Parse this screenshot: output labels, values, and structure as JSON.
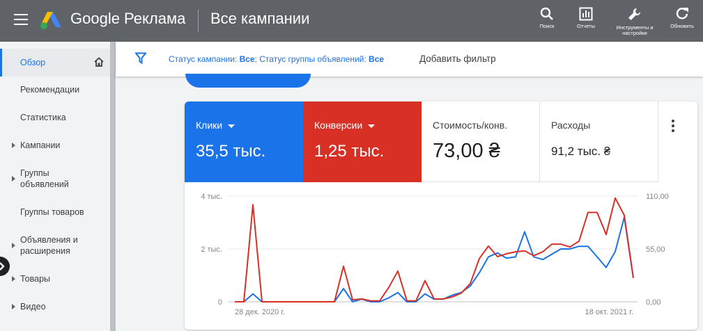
{
  "header": {
    "brand": "Google Реклама",
    "title": "Все кампании",
    "tools": [
      {
        "label": "Поиск",
        "icon": "search-icon"
      },
      {
        "label": "Отчеты",
        "icon": "reports-icon"
      },
      {
        "label": "Инструменты и настройки",
        "icon": "wrench-icon"
      },
      {
        "label": "Обновить",
        "icon": "refresh-icon"
      }
    ]
  },
  "sidebar": {
    "items": [
      {
        "label": "Обзор",
        "active": true
      },
      {
        "label": "Рекомендации"
      },
      {
        "label": "Статистика"
      },
      {
        "label": "Кампании",
        "expandable": true
      },
      {
        "label": "Группы объявлений",
        "expandable": true
      },
      {
        "label": "Группы товаров"
      },
      {
        "label": "Объявления и расширения",
        "expandable": true
      },
      {
        "label": "Товары",
        "expandable": true
      },
      {
        "label": "Видео",
        "expandable": true
      }
    ]
  },
  "filterbar": {
    "status_campaign_label": "Статус кампании: ",
    "status_campaign_value": "Все",
    "status_group_label": "; Статус группы объявлений: ",
    "status_group_value": "Все",
    "add_filter": "Добавить фильтр"
  },
  "metrics": {
    "clicks": {
      "label": "Клики",
      "value": "35,5 тыс."
    },
    "conversions": {
      "label": "Конверсии",
      "value": "1,25 тыс."
    },
    "cost_per_conv": {
      "label": "Стоимость/конв.",
      "value": "73,00 ₴"
    },
    "spend": {
      "label": "Расходы",
      "value": "91,2 тыс. ₴"
    }
  },
  "colors": {
    "clicks": "#1a73e8",
    "conversions": "#d93025",
    "header": "#5f6368"
  },
  "chart_data": {
    "type": "line",
    "x_start_label": "28 дек. 2020 г.",
    "x_end_label": "18 окт. 2021 г.",
    "left_axis": {
      "ticks": [
        "0",
        "2 тыс.",
        "4 тыс."
      ],
      "values": [
        0,
        2000,
        4000
      ]
    },
    "right_axis": {
      "ticks": [
        "0,00",
        "55,00",
        "110,00"
      ],
      "values": [
        0,
        55,
        110
      ]
    },
    "series": [
      {
        "name": "Клики",
        "axis": "left",
        "values": [
          0,
          0,
          300,
          0,
          0,
          0,
          0,
          0,
          0,
          0,
          0,
          0,
          500,
          0,
          100,
          0,
          0,
          150,
          350,
          0,
          0,
          300,
          100,
          100,
          250,
          350,
          600,
          1100,
          1700,
          1850,
          1650,
          1700,
          2650,
          1700,
          1600,
          1800,
          2000,
          2000,
          2100,
          2100,
          1700,
          1300,
          1900,
          3200,
          900
        ]
      },
      {
        "name": "Конверсии",
        "axis": "right",
        "values": [
          0,
          0,
          101,
          0,
          0,
          0,
          0,
          0,
          0,
          0,
          0,
          0,
          37,
          2,
          3,
          1,
          1,
          15,
          32,
          1,
          1,
          22,
          3,
          3,
          5,
          9,
          19,
          45,
          58,
          47,
          50,
          52,
          53,
          48,
          52,
          60,
          60,
          57,
          63,
          93,
          93,
          70,
          108,
          90,
          25
        ]
      }
    ]
  }
}
